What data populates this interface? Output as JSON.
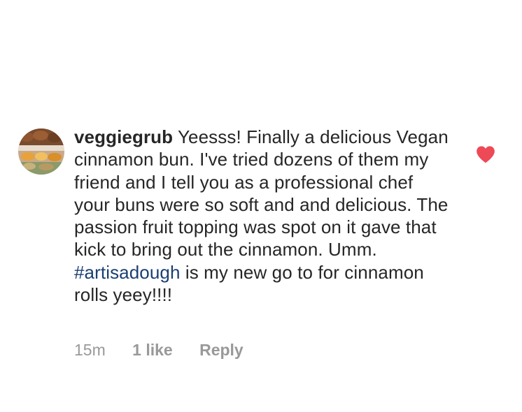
{
  "comment": {
    "avatar_icon": "food-photo-avatar",
    "username": "veggiegrub",
    "text_before_hashtag": "Yeesss! Finally a delicious Vegan cinnamon bun. I've tried dozens of them my friend and I tell you as a professional chef your buns were so soft and and delicious. The passion fruit topping was spot on it gave that kick to bring out the cinnamon. Umm.",
    "hashtag": "#artisadough",
    "text_after_hashtag": "is my new go to for cinnamon rolls yeey!!!!",
    "time": "15m",
    "likes": "1 like",
    "reply_label": "Reply",
    "liked": true,
    "heart_icon": "heart-icon",
    "colors": {
      "heart": "#ed4956",
      "hashtag": "#1b3f73",
      "meta": "#999999",
      "text": "#262626"
    }
  }
}
